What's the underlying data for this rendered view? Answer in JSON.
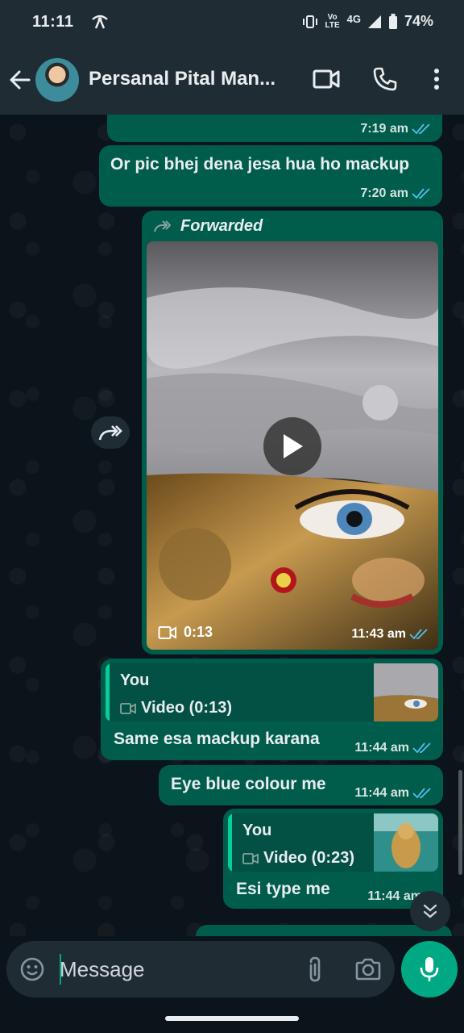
{
  "status_bar": {
    "time": "11:11",
    "network": "4G",
    "volte": "Vo LTE",
    "battery": "74%"
  },
  "header": {
    "contact_name": "Persanal Pital Man..."
  },
  "messages": [
    {
      "time": "7:19 am"
    },
    {
      "text": "Or pic bhej dena jesa hua ho mackup",
      "time": "7:20 am"
    },
    {
      "forwarded_label": "Forwarded",
      "duration": "0:13",
      "time": "11:43 am"
    },
    {
      "quote_sender": "You",
      "quote_body": "Video (0:13)",
      "text": "Same esa mackup karana",
      "time": "11:44 am"
    },
    {
      "text": "Eye blue colour me",
      "time": "11:44 am"
    },
    {
      "quote_sender": "You",
      "quote_body": "Video (0:23)",
      "text": "Esi type me",
      "time": "11:44 am"
    }
  ],
  "composer": {
    "placeholder": "Message"
  },
  "colors": {
    "outgoing_bubble": "#005c4b",
    "accent": "#00a884",
    "read_ticks": "#53bdeb",
    "header": "#1f2c34"
  },
  "icons": [
    "back-arrow-icon",
    "video-call-icon",
    "voice-call-icon",
    "more-options-icon",
    "forward-icon",
    "play-icon",
    "video-camera-icon",
    "emoji-icon",
    "attach-icon",
    "camera-icon",
    "mic-icon",
    "chevron-down-icon"
  ]
}
